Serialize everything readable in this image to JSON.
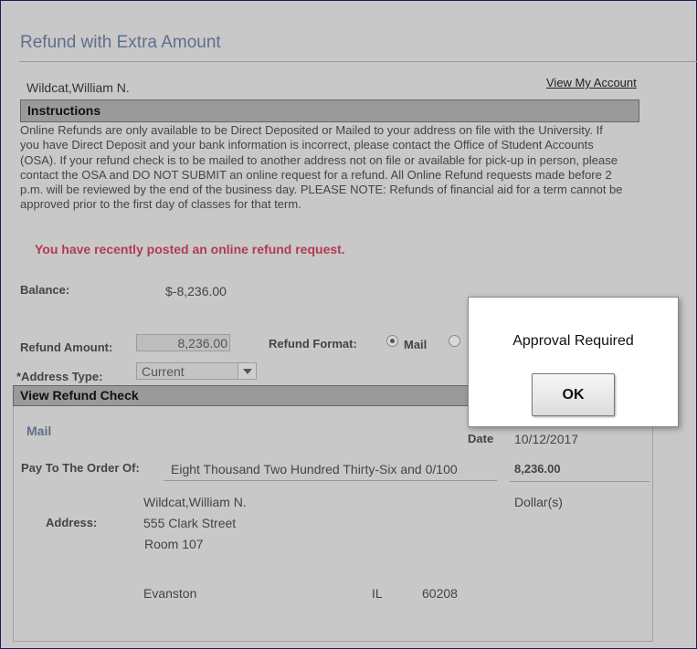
{
  "header": {
    "title": "Refund with Extra Amount",
    "student_name": "Wildcat,William N.",
    "view_account_label": "View My Account"
  },
  "instructions": {
    "heading": "Instructions",
    "body": "Online Refunds are only available to be Direct Deposited or Mailed to your address on file with the University. If you have Direct Deposit and your bank information is incorrect, please contact the Office of Student Accounts (OSA). If your refund check is to be mailed to another address not on file or available for pick-up in person, please contact the OSA and DO NOT SUBMIT an online request for a refund. All Online Refund requests made before 2 p.m. will be reviewed by the end of the business day. PLEASE NOTE: Refunds of financial aid for a term cannot be approved prior to the first day of classes for that term."
  },
  "notice": "You have recently posted an online refund request.",
  "balance": {
    "label": "Balance:",
    "value": "$-8,236.00"
  },
  "refund": {
    "amount_label": "Refund Amount:",
    "amount_value": "8,236.00",
    "format_label": "Refund Format:",
    "format_options": [
      {
        "label": "Mail",
        "selected": true
      },
      {
        "label": "",
        "selected": false
      }
    ],
    "address_type_label": "*Address Type:",
    "address_type_value": "Current"
  },
  "check": {
    "heading": "View Refund Check",
    "method": "Mail",
    "date_label": "Date",
    "date_value": "10/12/2017",
    "pay_to_label": "Pay To The Order Of:",
    "amount_words": "Eight Thousand Two Hundred Thirty-Six and 0/100",
    "amount_number": "8,236.00",
    "currency_label": "Dollar(s)",
    "address_label": "Address:",
    "address_lines": [
      "Wildcat,William N.",
      "555 Clark Street",
      "Room 107"
    ],
    "city": "Evanston",
    "state": "IL",
    "zip": "60208"
  },
  "modal": {
    "message": "Approval Required",
    "ok_label": "OK"
  }
}
